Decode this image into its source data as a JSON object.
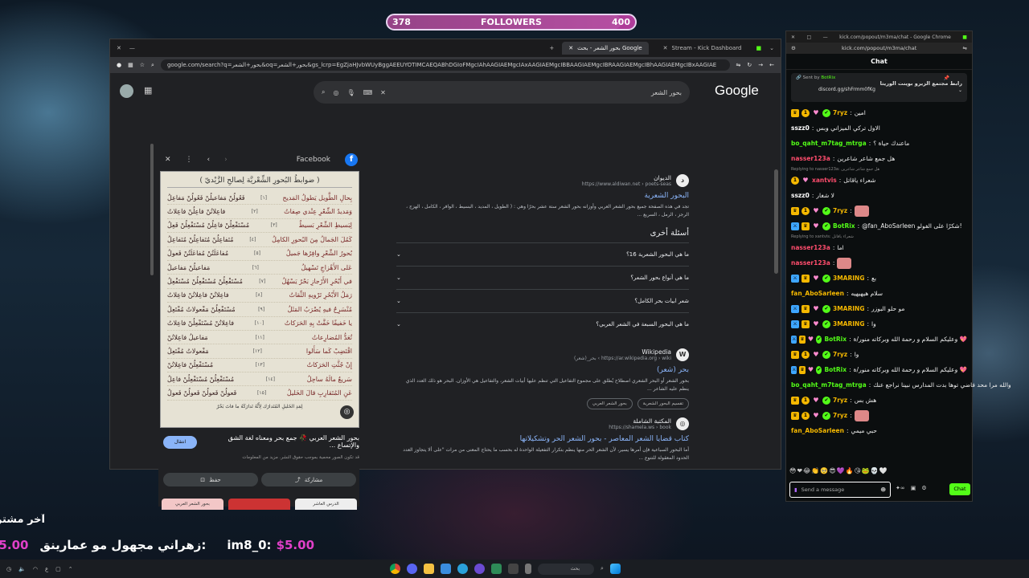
{
  "overlay": {
    "followers_current": "378",
    "followers_label": "FOLLOWERS",
    "followers_goal": "400",
    "followers_progress": 0.945,
    "donation_line1": "آخر مشتر",
    "donation_msg": "زهراني مجهول مو عمارينق:",
    "donation_user": "im8_0:",
    "donation_amount": "$5.00"
  },
  "browser": {
    "tabs": [
      "بحور الشعر - بحث Google",
      "Stream - Kick Dashboard"
    ],
    "url": "google.com/search?q=بحور+الشعر&oq=بحور+الشعر&gs_lcrp=EgZjaHJvbWUyBggAEEUYOTIMCAEQABhDGIoFMgcIAhAAGIAEMgcIAxAAGIAEMgcIBBAAGIAEMgcIBRAAGIAEMgcIBhAAGIAEMgcIBxAAGIAE",
    "search_query": "بحور الشعر",
    "logo": "Google"
  },
  "image_panel": {
    "source": "Facebook",
    "poem_title": "( ضوابطُ البُحورِ الشِّعْريَّة لِصالحِ الزَّيْديّ )",
    "lines": [
      {
        "n": "[١]",
        "a": "بِحالِ الطَّويل يَطولُ المَديح",
        "b": "فَعُولُنْ مَفاعيلُنْ فَعُولُنْ مَفاعِلُ"
      },
      {
        "n": "[٢]",
        "a": "وَمَديدُ الشِّعْرِ عِنْدي صِفاتُ",
        "b": "فاعِلاتُنْ فاعِلُنْ فاعِلاتُ"
      },
      {
        "n": "[٣]",
        "a": "لِبَسيطِ الشِّعْرِ بَسيطٌ",
        "b": "مُسْتَفْعِلُنْ فاعِلُنْ مُسْتَفْعِلُنْ فَعِلُ"
      },
      {
        "n": "[٤]",
        "a": "كَمُلَ الجَمالُ مِنَ البُحورِ الكامِلُ",
        "b": "مُتَفاعِلُنْ مُتَفاعِلُنْ مُتَفاعِلُ"
      },
      {
        "n": "[٥]",
        "a": "بُحورُ الشِّعْرِ وافِرُها جَميلُ",
        "b": "مُفاعَلَتُنْ مُفاعَلَتُنْ فَعولُ"
      },
      {
        "n": "[٦]",
        "a": "عَلى الأَهْزاجِ تَسْهيلُ",
        "b": "مَفاعيلُنْ مَفاعيلُ"
      },
      {
        "n": "[٧]",
        "a": "في أَبْحُرِ الأَرْجازِ بَحْرٌ يَسْهُلُ",
        "b": "مُسْتَفْعِلُنْ مُسْتَفْعِلُنْ مُسْتَفْعِلُ"
      },
      {
        "n": "[٨]",
        "a": "رَمَلُ الأَبْحُرِ تَرْويهِ الثِّقاتُ",
        "b": "فاعِلاتُنْ فاعِلاتُنْ فاعِلاتُ"
      },
      {
        "n": "[٩]",
        "a": "مُنْسَرِحٌ فيهِ يُضْرَبُ المَثَلُ",
        "b": "مُسْتَفْعِلُنْ مَفْعولاتُ مُفْتَعِلُ"
      },
      {
        "n": "[١٠]",
        "a": "يا خَفيفًا خَفَّتْ بِهِ الحَرَكاتُ",
        "b": "فاعِلاتُنْ مُسْتَفْعِلُنْ فاعِلاتُ"
      },
      {
        "n": "[١١]",
        "a": "تُعَدُّ المُضارِعاتُ",
        "b": "مَفاعيلُ فاعِلاتُنْ"
      },
      {
        "n": "[١٢]",
        "a": "اقْتَضِبْ كَما سَأَلوا",
        "b": "مَفْعولاتُ مُفْتَعِلُ"
      },
      {
        "n": "[١٣]",
        "a": "إِنْ جُثَّتِ الحَرَكاتُ",
        "b": "مُسْتَفْعِلُنْ فاعِلاتُنْ"
      },
      {
        "n": "[١٤]",
        "a": "سَريعٌ مالَهُ ساحِلُ",
        "b": "مُسْتَفْعِلُنْ مُسْتَفْعِلُنْ فاعِلُ"
      },
      {
        "n": "[١٥]",
        "a": "عَنِ المُتَقارِبِ قالَ الخَليلُ",
        "b": "فَعولُنْ فَعولُنْ فَعولُنْ فَعولُ"
      }
    ],
    "footnote": "لِمَدِ الخَليلِ المُتَدارَك لِأَنَّهُ تَدارَكَهُ ما فاتَ بَحْرٌ",
    "caption": "بحور الشعر العربي 🥀 جمع بحر ومعناه لغة الشق والإتساع ...",
    "visit": "انتقال",
    "rights": "قد تكون الصور محمية بموجب حقوق النشر. مزيد من المعلومات",
    "save": "حفظ",
    "share": "مشاركة",
    "thumbs": [
      "بحور الشعر العربي",
      "",
      "الدرس العاشر"
    ]
  },
  "results": [
    {
      "site": "الديوان",
      "url": "https://www.aldiwan.net › poets-seas",
      "title": "البحور الشعرية",
      "snippet": "تجد في هذه الصفحة جميع بحور الشعر العربي وأوزانه بحور الشعر ستة عشر بحرًا وهي : ( الطويل ، المديد ، البسيط ، الوافر ، الكامل ، الهزج ، الرجز ، الرمل ، السريع ..."
    },
    {
      "site": "Wikipedia",
      "url": "https://ar.wikipedia.org › wiki › بحر_(شعر)",
      "title": "بحر (شعر)",
      "snippet": "بحور الشعر أو البحر الشعري اصطلاح يُطلق على مجموع التفاعيل التي تنظم عليها أبيات الشعر، والتفاعيل هي الأوزان. البحر هو ذلك العدد الذي ينظم عليه الشاعر ..."
    },
    {
      "site": "المكتبة الشاملة",
      "url": "https://shamela.ws › book",
      "title": "كتاب قضايا الشعر المعاصر - بحور الشعر الحر وتشكيلاتها",
      "snippet": "أما البحور السباعية فإن أمرها يسير، لأن الشعر الحر منها ينظم بتكرار التفعيلة الواحدة له بحسب ما يحتاج المعنى من مرات \"على ألا يتجاوز العدد الحدود المعقولة للتنوع ..."
    }
  ],
  "paa": {
    "title": "أسئلة أخرى",
    "questions": [
      "ما هي البحور الشعرية 16؟",
      "ما هي أنواع بحور الشعر؟",
      "شعر ابيات بحر الكامل؟",
      "ما هي البحور السبعة في الشعر العربي؟"
    ]
  },
  "wiki_chips": [
    "تقسيم البحور الشعرية",
    "بحور الشعر العربي"
  ],
  "chat": {
    "window_title": "kick.com/popout/m3ma/chat - Google Chrome",
    "url": "kick.com/popout/m3ma/chat",
    "header": "Chat",
    "pinned_by": "Sent by",
    "pinned_user": "BotRix",
    "pinned_text": "رابط مجتمع الزيرو بوينت الوريتا",
    "pinned_link": "discord.gg/shFrmm0fKg",
    "messages": [
      {
        "user": "7ryz",
        "color": "#f5b800",
        "badges": [
          "crown",
          "one",
          "heart",
          "ver"
        ],
        "text": "امين"
      },
      {
        "user": "sszz0",
        "color": "#ffffff",
        "badges": [],
        "text": "الاول تركي الميزاني وبس"
      },
      {
        "user": "bo_qaht_m7tag_mtrga",
        "color": "#53fc18",
        "badges": [],
        "text": "ماعندك حياة ؟"
      },
      {
        "user": "nasser123a",
        "color": "#ff4d6d",
        "badges": [],
        "text": "هل جمع شاعر شاعرين"
      },
      {
        "reply": "Replying to nasser123a: هل جمع شاعر شاعرين",
        "user": "xantvis",
        "color": "#ff4d6d",
        "badges": [
          "one",
          "heart"
        ],
        "text": "شعراء ياقاتل"
      },
      {
        "user": "sszz0",
        "color": "#ffffff",
        "badges": [],
        "text": "لا شغار"
      },
      {
        "user": "7ryz",
        "color": "#f5b800",
        "badges": [
          "crown",
          "one",
          "heart",
          "ver"
        ],
        "text": "",
        "emote": true
      },
      {
        "user": "BotRix",
        "color": "#53fc18",
        "badges": [
          "sword",
          "crown",
          "heart",
          "ver"
        ],
        "text": "@fan_AboSarleen شكرًا على الفولو!"
      },
      {
        "reply": "Replying to xantvis: شعراء ياقاتل",
        "user": "nasser123a",
        "color": "#ff4d6d",
        "badges": [],
        "text": "اما"
      },
      {
        "user": "nasser123a",
        "color": "#ff4d6d",
        "badges": [],
        "text": "",
        "emote": true
      },
      {
        "user": "3MARING",
        "color": "#f5b800",
        "badges": [
          "sword",
          "crown",
          "heart",
          "ver"
        ],
        "text": "بع"
      },
      {
        "user": "fan_AboSarleen",
        "color": "#f5b800",
        "badges": [],
        "text": "سلام هيهيهيه"
      },
      {
        "user": "3MARING",
        "color": "#f5b800",
        "badges": [
          "sword",
          "crown",
          "heart",
          "ver"
        ],
        "text": "مو حلو البوزر"
      },
      {
        "user": "3MARING",
        "color": "#f5b800",
        "badges": [
          "sword",
          "crown",
          "heart",
          "ver"
        ],
        "text": "وا"
      },
      {
        "user": "BotRix",
        "color": "#53fc18",
        "badges": [
          "sword",
          "crown",
          "heart",
          "ver"
        ],
        "text": "وعليكم السلام و رحمة الله وبركاته منور/ة 💖"
      },
      {
        "user": "7ryz",
        "color": "#f5b800",
        "badges": [
          "crown",
          "one",
          "heart",
          "ver"
        ],
        "text": "وا"
      },
      {
        "user": "BotRix",
        "color": "#53fc18",
        "badges": [
          "sword",
          "crown",
          "heart",
          "ver"
        ],
        "text": "وعليكم السلام و رحمة الله وبركاته منور/ة 💖"
      },
      {
        "user": "bo_qaht_m7tag_mtrga",
        "color": "#53fc18",
        "badges": [],
        "text": "والله مرا محد فاضي توها بدت المدارس نبينا نراجع عنك"
      },
      {
        "user": "7ryz",
        "color": "#f5b800",
        "badges": [
          "crown",
          "one",
          "heart",
          "ver"
        ],
        "text": "هش بس"
      },
      {
        "user": "7ryz",
        "color": "#f5b800",
        "badges": [
          "crown",
          "one",
          "heart",
          "ver"
        ],
        "text": "",
        "emote": true
      },
      {
        "user": "fan_AboSarleen",
        "color": "#f5b800",
        "badges": [],
        "text": "حبي ميمي"
      }
    ],
    "input_placeholder": "Send a message",
    "send_label": "Chat"
  },
  "taskbar": {
    "search_placeholder": "بحث",
    "lang": "ع"
  }
}
